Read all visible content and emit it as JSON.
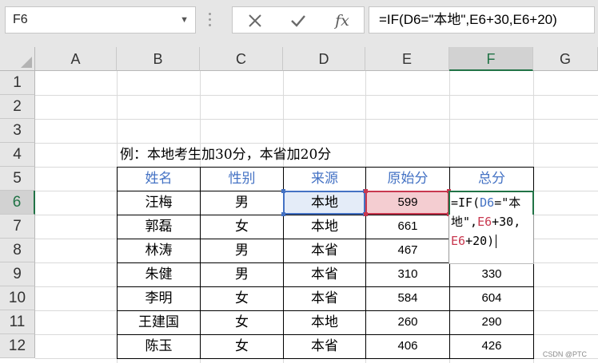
{
  "formula_bar": {
    "name_box": "F6",
    "cancel_icon": "close-icon",
    "enter_icon": "check-icon",
    "fx_label": "fx",
    "formula": "=IF(D6=\"本地\",E6+30,E6+20)"
  },
  "columns": [
    "A",
    "B",
    "C",
    "D",
    "E",
    "F",
    "G"
  ],
  "rows": [
    "1",
    "2",
    "3",
    "4",
    "5",
    "6",
    "7",
    "8",
    "9",
    "10",
    "11",
    "12"
  ],
  "note": "例：本地考生加30分，本省加20分",
  "table": {
    "headers": [
      "姓名",
      "性别",
      "来源",
      "原始分",
      "总分"
    ],
    "rows": [
      [
        "汪梅",
        "男",
        "本地",
        "599",
        ""
      ],
      [
        "郭磊",
        "女",
        "本地",
        "661",
        ""
      ],
      [
        "林涛",
        "男",
        "本省",
        "467",
        ""
      ],
      [
        "朱健",
        "男",
        "本省",
        "310",
        "330"
      ],
      [
        "李明",
        "女",
        "本省",
        "584",
        "604"
      ],
      [
        "王建国",
        "女",
        "本地",
        "260",
        "290"
      ],
      [
        "陈玉",
        "女",
        "本省",
        "406",
        "426"
      ]
    ]
  },
  "editor": {
    "line1_a": "=IF(",
    "line1_ref": "D6",
    "line1_b": "=\"本",
    "line2_a": "地\",",
    "line2_ref": "E6",
    "line2_b": "+30,",
    "line3_ref": "E6",
    "line3_b": "+20)"
  },
  "watermark": "CSDN @PTC",
  "colors": {
    "header_text": "#4472c4",
    "ref_blue": "#4472c4",
    "ref_red": "#c8384f",
    "active_green": "#217346"
  }
}
